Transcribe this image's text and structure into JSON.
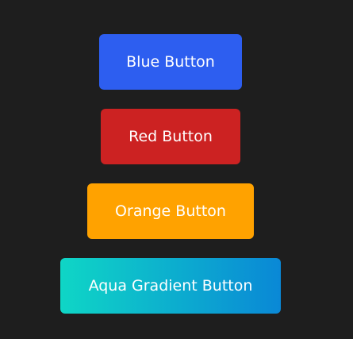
{
  "buttons": [
    {
      "label": "Blue Button",
      "color": "#2d5ef0"
    },
    {
      "label": "Red Button",
      "color": "#cc2222"
    },
    {
      "label": "Orange Button",
      "color": "#ffa200"
    },
    {
      "label": "Aqua Gradient Button",
      "gradient": [
        "#0fd6c6",
        "#0a88d6"
      ]
    }
  ],
  "background_color": "#1e1e1e"
}
